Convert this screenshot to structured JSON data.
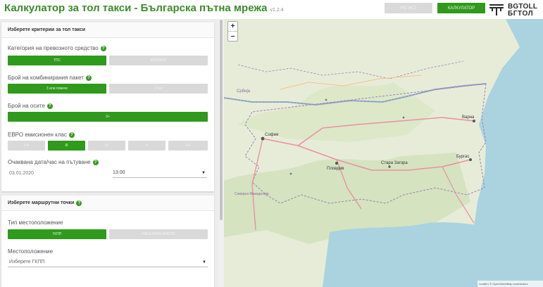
{
  "header": {
    "title": "Калкулатор за тол такси - Българска пътна мрежа",
    "version": "v1.2.4",
    "btn_grey_label": "РЕГИСТ",
    "btn_green_label": "КАЛКУЛАТОР",
    "logo_line1": "BGTOLL",
    "logo_line2": "БГТОЛ"
  },
  "criteria": {
    "heading": "Изберете критерии за тол такси",
    "vehicle_category_label": "Категория на превозното средство",
    "vehicle_options": [
      "ТПС",
      "АВТОБУС"
    ],
    "axles_label": "Брой на комбинирания пакет",
    "axles_options": [
      "3 или повече",
      "2 оси"
    ],
    "axle_count_label": "Брой на осите",
    "axle_count_value": "3+",
    "euro_label": "ЕВРО емисионен клас",
    "euro_options": [
      "0-II",
      "III",
      "IV",
      "V",
      "VI+"
    ],
    "datetime_label": "Очаквана дата/час на пътуване",
    "date_value": "03.01.2020",
    "time_value": "13:00"
  },
  "route": {
    "heading": "Изберете маршрутни точки",
    "location_type_label": "Тип местоположение",
    "location_type_options": [
      "ГКПП",
      "НАСЕЛЕНО МЯСТО"
    ],
    "location_label": "Местоположение",
    "location_placeholder": "Изберете ГКПП"
  },
  "map": {
    "zoom_in": "+",
    "zoom_out": "−",
    "attribution": "Leaflet | © OpenStreetMap contributors",
    "labels": {
      "srbija": "Србија",
      "sofia": "София",
      "varna": "Варна",
      "burgas": "Бургас",
      "plovdiv": "Пловдив",
      "stara_zagora": "Стара Загора",
      "severna_makedonija": "Северна Македонија"
    },
    "colors": {
      "land": "#e7ecd8",
      "sea": "#aad3df",
      "road": "#e892a2",
      "border": "#9e7fb6"
    }
  }
}
